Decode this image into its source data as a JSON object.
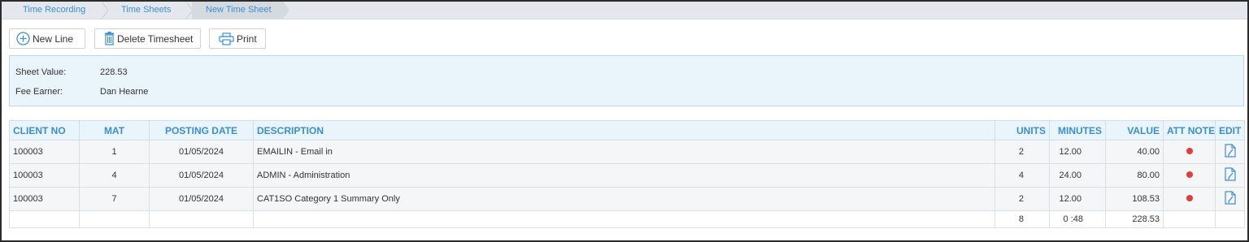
{
  "breadcrumb": {
    "items": [
      {
        "label": "Time Recording"
      },
      {
        "label": "Time Sheets"
      },
      {
        "label": "New Time Sheet"
      }
    ]
  },
  "toolbar": {
    "new_line_label": "New Line",
    "delete_label": "Delete Timesheet",
    "print_label": "Print"
  },
  "sheet": {
    "value_label": "Sheet Value:",
    "value": "228.53",
    "fee_earner_label": "Fee Earner:",
    "fee_earner": "Dan Hearne"
  },
  "table": {
    "headers": {
      "client_no": "CLIENT NO",
      "mat": "MAT",
      "posting_date": "POSTING DATE",
      "description": "DESCRIPTION",
      "units": "UNITS",
      "minutes": "MINUTES",
      "value": "VALUE",
      "att_note": "ATT NOTE",
      "edit": "EDIT"
    },
    "rows": [
      {
        "client_no": "100003",
        "mat": "1",
        "posting_date": "01/05/2024",
        "description": "EMAILIN - Email in",
        "units": "2",
        "minutes": "12.00",
        "value": "40.00"
      },
      {
        "client_no": "100003",
        "mat": "4",
        "posting_date": "01/05/2024",
        "description": "ADMIN - Administration",
        "units": "4",
        "minutes": "24.00",
        "value": "80.00"
      },
      {
        "client_no": "100003",
        "mat": "7",
        "posting_date": "01/05/2024",
        "description": "CAT1SO Category 1 Summary Only",
        "units": "2",
        "minutes": "12.00",
        "value": "108.53"
      }
    ],
    "totals": {
      "units": "8",
      "minutes": "0 :48",
      "value": "228.53"
    }
  },
  "colors": {
    "accent": "#3a8fd4",
    "att_note_dot": "#e03d3d",
    "panel_bg": "#eaf4fb"
  },
  "icons": {
    "new_line": "plus-circle-icon",
    "delete": "trash-icon",
    "print": "printer-icon",
    "edit": "edit-document-icon",
    "att_note": "red-dot-indicator"
  }
}
